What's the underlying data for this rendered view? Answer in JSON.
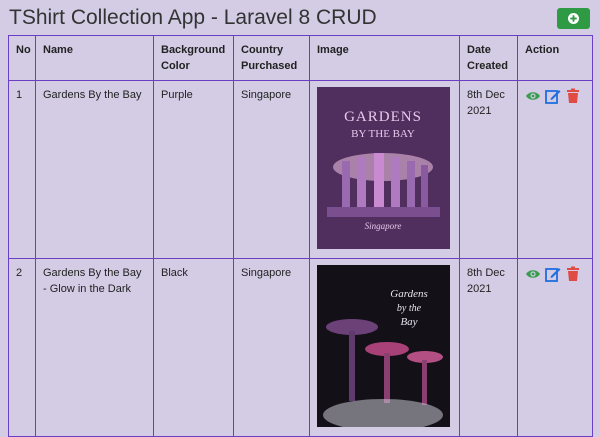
{
  "page": {
    "title": "TShirt Collection App - Laravel 8 CRUD",
    "add_icon": "plus-circle-icon",
    "accent_color": "#2e9a44",
    "border_color": "#6a3fc3",
    "background": "#d3cce4"
  },
  "table": {
    "headers": {
      "no": "No",
      "name": "Name",
      "bg_color": "Background Color",
      "country": "Country Purchased",
      "image": "Image",
      "date": "Date Created",
      "action": "Action"
    },
    "rows": [
      {
        "no": "1",
        "name": "Gardens By the Bay",
        "bg_color": "Purple",
        "country": "Singapore",
        "image_title": "GARDENS BY THE BAY",
        "image_script": "Singapore",
        "date": "8th Dec 2021"
      },
      {
        "no": "2",
        "name": "Gardens By the Bay - Glow in the Dark",
        "bg_color": "Black",
        "country": "Singapore",
        "image_title": "Gardens by the Bay",
        "date": "8th Dec 2021"
      }
    ],
    "action_icons": [
      "eye-icon",
      "edit-icon",
      "trash-icon"
    ],
    "action_colors": {
      "view": "#3a9c4e",
      "edit": "#1f6fe0",
      "delete": "#e04b43"
    }
  }
}
